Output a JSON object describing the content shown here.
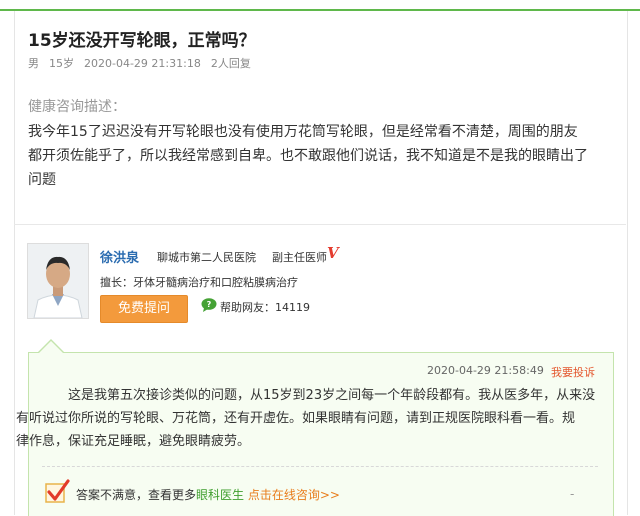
{
  "question": {
    "title": "15岁还没开写轮眼，正常吗？",
    "meta": {
      "gender": "男",
      "age": "15岁",
      "time": "2020-04-29 21:31:18",
      "reply_count": "2人回复"
    },
    "desc_label": "健康咨询描述：",
    "desc_lines": [
      "我今年15了迟迟没有开写轮眼也没有使用万花筒写轮眼，但是经常看不清楚，周围的朋友",
      "都开须佐能乎了，所以我经常感到自卑。也不敢跟他们说话，我不知道是不是我的眼睛出了",
      "问题"
    ]
  },
  "doctor": {
    "name": "徐洪泉",
    "hospital": "聊城市第二人民医院",
    "title": "副主任医师",
    "v_badge": "V",
    "specialty": "擅长：牙体牙髓病治疗和口腔粘膜病治疗",
    "consult_button": "免费提问",
    "help_text": "帮助网友：14119"
  },
  "answer": {
    "time": "2020-04-29 21:58:49",
    "report_label": "我要投诉",
    "body_lines": [
      "这是我第五次接诊类似的问题，从15岁到23岁之间每一个年龄段都有。我从医多年，从来没",
      "有听说过你所说的写轮眼、万花筒，还有开虚佐。如果眼睛有问题，请到正规医院眼科看一看。规",
      "律作息，保证充足睡眠，避免眼睛疲劳。"
    ],
    "unsatisfied": {
      "prefix": "答案不满意，查看更多",
      "green": "眼科医生",
      "link": "点击在线咨询>>"
    },
    "more_dash": "-"
  },
  "colors": {
    "accent_green": "#5fb84b",
    "button_orange": "#f39a3c",
    "name_blue": "#2b6cb0",
    "report_red": "#e4572e"
  },
  "icons": [
    "v-badge-icon",
    "help-bubble-icon",
    "checkmark-icon"
  ]
}
